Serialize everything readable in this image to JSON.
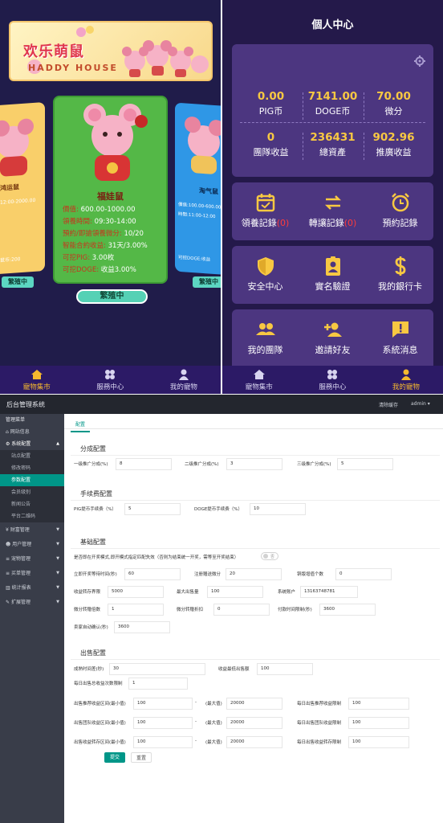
{
  "mobile_home": {
    "banner": {
      "title": "欢乐萌鼠",
      "subtitle": "HADDY HOUSE"
    },
    "cards": [
      {
        "name": "鸿运鼠",
        "rows": [
          "",
          "12:00-2000.00",
          "",
          "",
          "",
          "",
          "鼠币:200"
        ],
        "button": "繁殖中"
      },
      {
        "name": "福娃鼠",
        "rows": [
          {
            "label": "價值:",
            "value": "600.00-1000.00"
          },
          {
            "label": "領養時間:",
            "value": "09:30-14:00"
          },
          {
            "label": "預約/即搶領養微分:",
            "value": "10/20"
          },
          {
            "label": "智能合約收益:",
            "value": "31天/3.00%"
          },
          {
            "label": "可挖PIG:",
            "value": "3.00枚"
          },
          {
            "label": "可挖DOGE:",
            "value": "收益3.00%"
          }
        ],
        "button": "繁殖中"
      },
      {
        "name": "淘气鼠",
        "rows": [
          "價值:100.00-600.00",
          "時間:11:00-12:00",
          "",
          "",
          "",
          "可挖DOGE:收益"
        ],
        "button": "繁殖中"
      }
    ],
    "tabs": [
      {
        "label": "寵物集市",
        "icon": "home-icon"
      },
      {
        "label": "服務中心",
        "icon": "grid-icon"
      },
      {
        "label": "我的寵物",
        "icon": "user-icon"
      }
    ]
  },
  "mobile_profile": {
    "title": "個人中心",
    "stats": [
      {
        "value": "0.00",
        "label": "PIG币"
      },
      {
        "value": "7141.00",
        "label": "DOGE币"
      },
      {
        "value": "70.00",
        "label": "微分"
      },
      {
        "value": "0",
        "label": "團隊收益"
      },
      {
        "value": "236431",
        "label": "總資產"
      },
      {
        "value": "902.96",
        "label": "推廣收益"
      }
    ],
    "menu": [
      {
        "label": "領養記錄",
        "badge": "(0)",
        "icon": "calendar-icon"
      },
      {
        "label": "轉讓記錄",
        "badge": "(0)",
        "icon": "transfer-icon"
      },
      {
        "label": "預約記錄",
        "icon": "alarm-icon"
      },
      {
        "label": "安全中心",
        "icon": "shield-icon"
      },
      {
        "label": "實名驗證",
        "icon": "id-badge-icon"
      },
      {
        "label": "我的銀行卡",
        "icon": "dollar-icon"
      },
      {
        "label": "我的團隊",
        "icon": "team-icon"
      },
      {
        "label": "邀請好友",
        "icon": "add-user-icon"
      },
      {
        "label": "系統消息",
        "icon": "message-icon"
      }
    ],
    "tabs": [
      {
        "label": "寵物集市",
        "icon": "home-icon"
      },
      {
        "label": "服務中心",
        "icon": "grid-icon"
      },
      {
        "label": "我的寵物",
        "icon": "user-icon"
      }
    ]
  },
  "admin": {
    "brand": "后台管理系统",
    "clear_cache": "清除缓存",
    "user": "admin ▾",
    "sidebar": [
      {
        "label": "管理菜单"
      },
      {
        "label": "网站信息"
      },
      {
        "label": "系统配置"
      },
      {
        "label": "站点配置"
      },
      {
        "label": "修改密码"
      },
      {
        "label": "参数配置"
      },
      {
        "label": "会员级别"
      },
      {
        "label": "新闻公告"
      },
      {
        "label": "平台二维码"
      },
      {
        "label": "财富管理"
      },
      {
        "label": "用户管理"
      },
      {
        "label": "宠物管理"
      },
      {
        "label": "买单管理"
      },
      {
        "label": "统计报表"
      },
      {
        "label": "扩展管理"
      }
    ],
    "tab": "配置",
    "sections": {
      "share": "分成配置",
      "fee": "手续费配置",
      "basic": "基础配置",
      "sell": "出售配置"
    },
    "share_fields": [
      {
        "label": "一级推广分成(%)",
        "value": "8"
      },
      {
        "label": "二级推广分成(%)",
        "value": "3"
      },
      {
        "label": "三级推广分成(%)",
        "value": "5"
      }
    ],
    "fee_fields": [
      {
        "label": "PIG提币手续费（%）",
        "value": "5"
      },
      {
        "label": "DOGE提币手续费（%）",
        "value": "10"
      }
    ],
    "basic_toggle": {
      "label": "是否即在开奖模式,即开模式指定匹配失效（否则为结束统一开奖，需等至开奖结束）",
      "value": "否"
    },
    "basic_fields": [
      {
        "label": "立即开奖等待时间(秒)",
        "value": "60"
      },
      {
        "label": "注册赠送微分",
        "value": "20"
      },
      {
        "label": "铜版增值个数",
        "value": "0"
      },
      {
        "label": "收益转存界限",
        "value": "5000"
      },
      {
        "label": "最大出售量",
        "value": "100"
      },
      {
        "label": "系统账户",
        "value": "13163748781"
      },
      {
        "label": "微分转赠倍数",
        "value": "1"
      },
      {
        "label": "微分转赠折扣",
        "value": "0"
      },
      {
        "label": "付款时间限制(秒)",
        "value": "3600"
      },
      {
        "label": "卖家自动确认(秒)",
        "value": "3600"
      }
    ],
    "sell_fields": [
      {
        "label": "成熟时间差(秒)",
        "value": "30"
      },
      {
        "label": "收益最低出售额",
        "value": "100"
      },
      {
        "label": "每日出售总收益次数限制",
        "value": "1"
      }
    ],
    "sell_rows": [
      {
        "min_label": "出售推荐收益区间(最小值)",
        "min": "100",
        "max_label": "(最大值)",
        "max": "20000",
        "lim_label": "每日出售推荐收益限制",
        "lim": "100"
      },
      {
        "min_label": "出售团队收益区间(最小值)",
        "min": "100",
        "max_label": "(最大值)",
        "max": "20000",
        "lim_label": "每日出售团队收益限制",
        "lim": "100"
      },
      {
        "min_label": "出售收益转存区间(最小值)",
        "min": "100",
        "max_label": "(最大值)",
        "max": "20000",
        "lim_label": "每日出售收益转存限制",
        "lim": "100"
      }
    ],
    "dash": "-",
    "submit": "提交",
    "reset": "重置"
  }
}
